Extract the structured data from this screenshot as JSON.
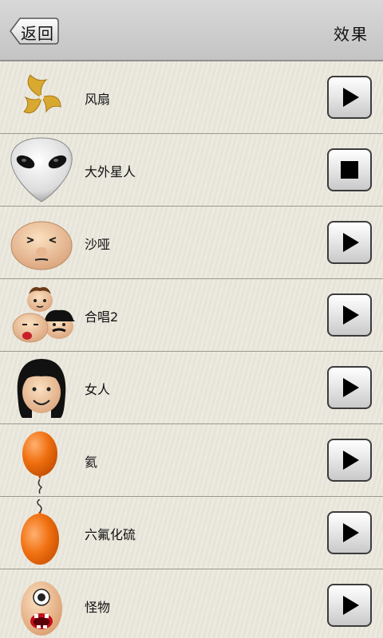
{
  "header": {
    "back_label": "返回",
    "title": "效果"
  },
  "effects": [
    {
      "label": "风扇",
      "icon": "fan-icon",
      "button": "play"
    },
    {
      "label": "大外星人",
      "icon": "alien-icon",
      "button": "stop"
    },
    {
      "label": "沙哑",
      "icon": "hoarse-face-icon",
      "button": "play"
    },
    {
      "label": "合唱2",
      "icon": "chorus-faces-icon",
      "button": "play"
    },
    {
      "label": "女人",
      "icon": "woman-face-icon",
      "button": "play"
    },
    {
      "label": "氦",
      "icon": "balloon-icon",
      "button": "play"
    },
    {
      "label": "六氟化硫",
      "icon": "heavy-balloon-icon",
      "button": "play"
    },
    {
      "label": "怪物",
      "icon": "monster-icon",
      "button": "play"
    }
  ],
  "colors": {
    "balloon": "#f07010",
    "fan": "#d8a830",
    "skin": "#f1c9a2"
  }
}
